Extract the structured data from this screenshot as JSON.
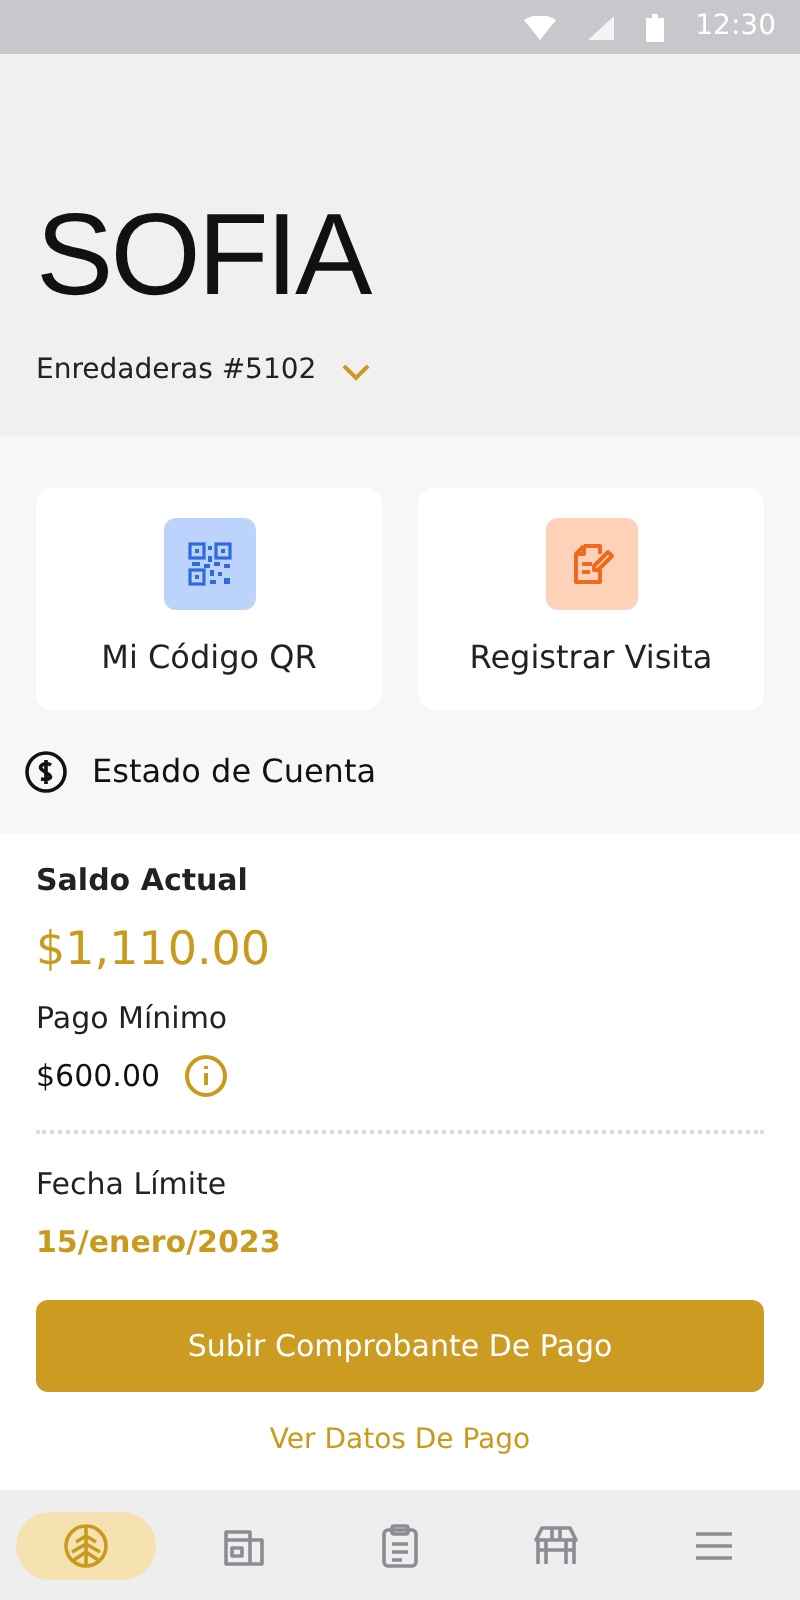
{
  "status_bar": {
    "time": "12:30"
  },
  "header": {
    "name": "SOFIA",
    "address": "Enredaderas #5102"
  },
  "actions": [
    {
      "kind": "qr",
      "label": "Mi Código QR"
    },
    {
      "kind": "visit",
      "label": "Registrar Visita"
    }
  ],
  "account": {
    "title": "Estado de Cuenta",
    "balance_label": "Saldo Actual",
    "balance": "$1,110.00",
    "minimum_label": "Pago Mínimo",
    "minimum": "$600.00",
    "due_label": "Fecha Límite",
    "due_date": "15/enero/2023",
    "upload_button": "Subir Comprobante De Pago",
    "payment_link": "Ver Datos De Pago"
  },
  "bottom_nav": [
    {
      "kind": "home",
      "selected": true
    },
    {
      "kind": "building",
      "selected": false
    },
    {
      "kind": "clipboard",
      "selected": false
    },
    {
      "kind": "store",
      "selected": false
    },
    {
      "kind": "menu",
      "selected": false
    }
  ]
}
